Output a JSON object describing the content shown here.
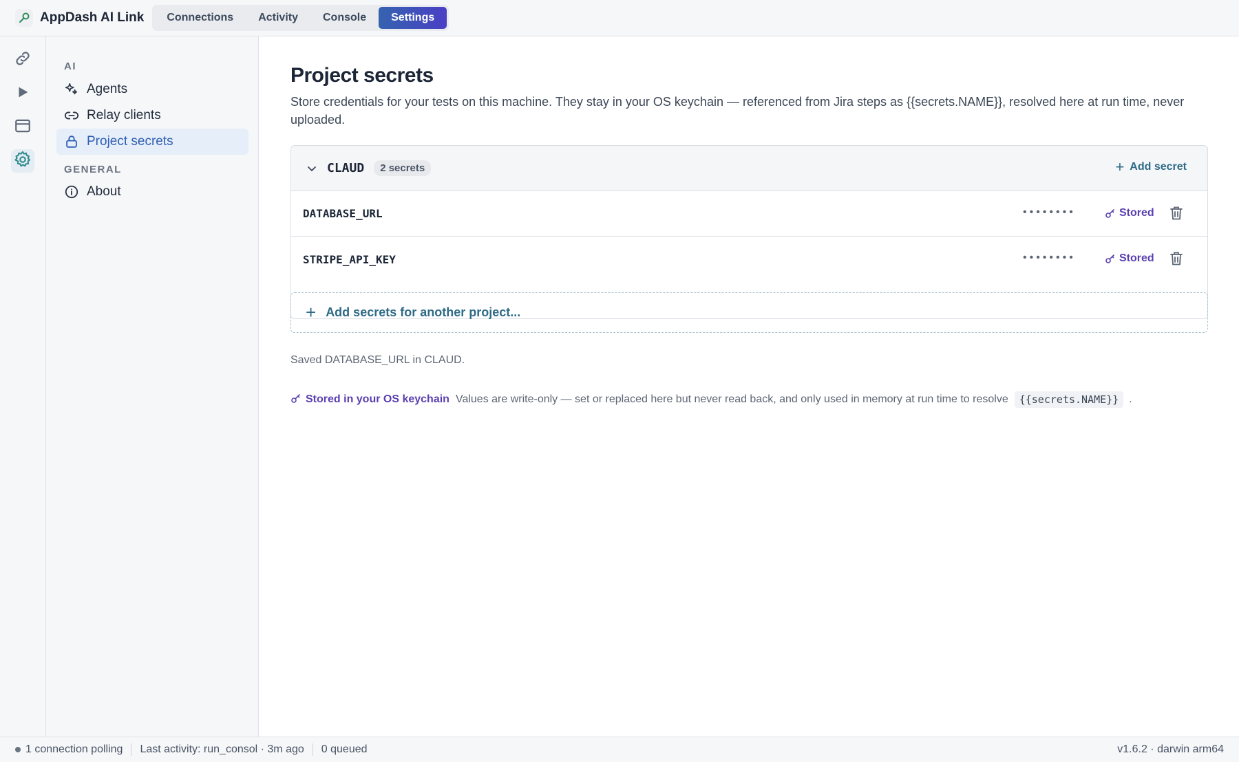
{
  "app": {
    "title": "AppDash AI Link"
  },
  "tabs": [
    {
      "label": "Connections"
    },
    {
      "label": "Activity"
    },
    {
      "label": "Console"
    },
    {
      "label": "Settings",
      "active": true
    }
  ],
  "rail": [
    {
      "icon": "link-icon"
    },
    {
      "icon": "play-icon"
    },
    {
      "icon": "window-icon"
    },
    {
      "icon": "gear-icon",
      "active": true
    }
  ],
  "nav": {
    "sections": [
      {
        "title": "AI",
        "items": [
          {
            "label": "Agents",
            "icon": "sparkles-icon"
          },
          {
            "label": "Relay clients",
            "icon": "link-icon"
          },
          {
            "label": "Project secrets",
            "icon": "lock-icon",
            "active": true
          }
        ]
      },
      {
        "title": "GENERAL",
        "items": [
          {
            "label": "About",
            "icon": "info-icon"
          }
        ]
      }
    ]
  },
  "page": {
    "title": "Project secrets",
    "description": "Store credentials for your tests on this machine. They stay in your OS keychain — referenced from Jira steps as {{secrets.NAME}}, resolved here at run time, never uploaded."
  },
  "project": {
    "name": "CLAUD",
    "count_label": "2 secrets",
    "add_label": "Add secret",
    "secrets": [
      {
        "name": "DATABASE_URL",
        "masked": "••••••••",
        "status": "Stored"
      },
      {
        "name": "STRIPE_API_KEY",
        "masked": "••••••••",
        "status": "Stored"
      }
    ]
  },
  "add_another_label": "Add secrets for another project...",
  "saved_message": "Saved DATABASE_URL in CLAUD.",
  "keychain_note": {
    "title": "Stored in your OS keychain",
    "text": "Values are write-only — set or replaced here but never read back, and only used in memory at run time to resolve",
    "code": "{{secrets.NAME}}",
    "end": "."
  },
  "statusbar": {
    "connections": "1 connection polling",
    "last_activity": "Last activity: run_consol · 3m ago",
    "queued": "0 queued",
    "version": "v1.6.2 · darwin arm64"
  }
}
